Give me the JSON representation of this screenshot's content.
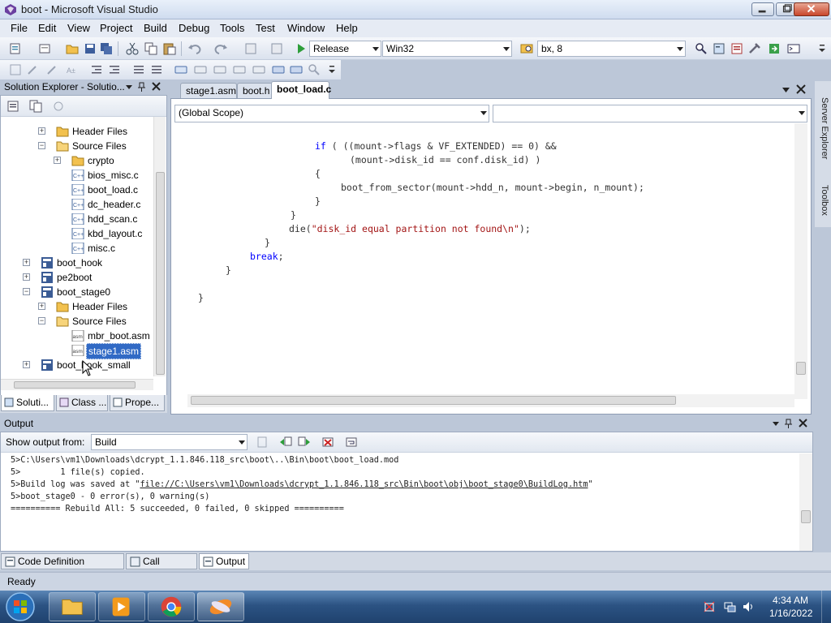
{
  "window": {
    "title": "boot - Microsoft Visual Studio"
  },
  "menu": [
    "File",
    "Edit",
    "View",
    "Project",
    "Build",
    "Debug",
    "Tools",
    "Test",
    "Window",
    "Help"
  ],
  "toolbar": {
    "configuration": "Release",
    "platform": "Win32",
    "find_value": "bx, 8"
  },
  "solution_explorer": {
    "title": "Solution Explorer - Solutio...",
    "tree": [
      {
        "label": "Header Files"
      },
      {
        "label": "Source Files"
      },
      {
        "label": "crypto"
      },
      {
        "label": "bios_misc.c"
      },
      {
        "label": "boot_load.c"
      },
      {
        "label": "dc_header.c"
      },
      {
        "label": "hdd_scan.c"
      },
      {
        "label": "kbd_layout.c"
      },
      {
        "label": "misc.c"
      },
      {
        "label": "boot_hook"
      },
      {
        "label": "pe2boot"
      },
      {
        "label": "boot_stage0"
      },
      {
        "label": "Header Files"
      },
      {
        "label": "Source Files"
      },
      {
        "label": "mbr_boot.asm"
      },
      {
        "label": "stage1.asm"
      },
      {
        "label": "boot_hook_small"
      }
    ],
    "tabs": [
      "Soluti...",
      "Class ...",
      "Prope..."
    ]
  },
  "editor": {
    "tabs": [
      "stage1.asm",
      "boot.h",
      "boot_load.c"
    ],
    "scope": "(Global Scope)",
    "code": {
      "l1a": "if",
      "l1b": " ( ((mount->flags & VF_EXTENDED) == 0) &&",
      "l2": "(mount->disk_id == conf.disk_id) )",
      "l3": "{",
      "l4": "boot_from_sector(mount->hdd_n, mount->begin, n_mount);",
      "l5": "}",
      "l6": "}",
      "l7a": "die(",
      "l7b": "\"disk_id equal partition not found\\n\"",
      "l7c": ");",
      "l8": "}",
      "l9a": "break",
      "l9b": ";",
      "l10": "}",
      "l11": "}"
    }
  },
  "right_strip": {
    "server_explorer": "Server Explorer",
    "toolbox": "Toolbox"
  },
  "output": {
    "title": "Output",
    "show_from_label": "Show output from:",
    "show_from_value": "Build",
    "lines": {
      "l1": "5>C:\\Users\\vm1\\Downloads\\dcrypt_1.1.846.118_src\\boot\\..\\Bin\\boot\\boot_load.mod",
      "l2": "5>        1 file(s) copied.",
      "l3a": "5>Build log was saved at \"",
      "l3b": "file://C:\\Users\\vm1\\Downloads\\dcrypt_1.1.846.118_src\\Bin\\boot\\obj\\boot_stage0\\BuildLog.htm",
      "l3c": "\"",
      "l4": "5>boot_stage0 - 0 error(s), 0 warning(s)",
      "l5": "========== Rebuild All: 5 succeeded, 0 failed, 0 skipped =========="
    }
  },
  "bottom_tabs": [
    "Code Definition Window",
    "Call Browser",
    "Output"
  ],
  "status": {
    "text": "Ready"
  },
  "taskbar": {
    "time": "4:34 AM",
    "date": "1/16/2022"
  },
  "colors": {
    "keyword": "#0000ff",
    "string": "#a31515",
    "selection": "#316ac5",
    "taskbar": "#2c5383"
  }
}
